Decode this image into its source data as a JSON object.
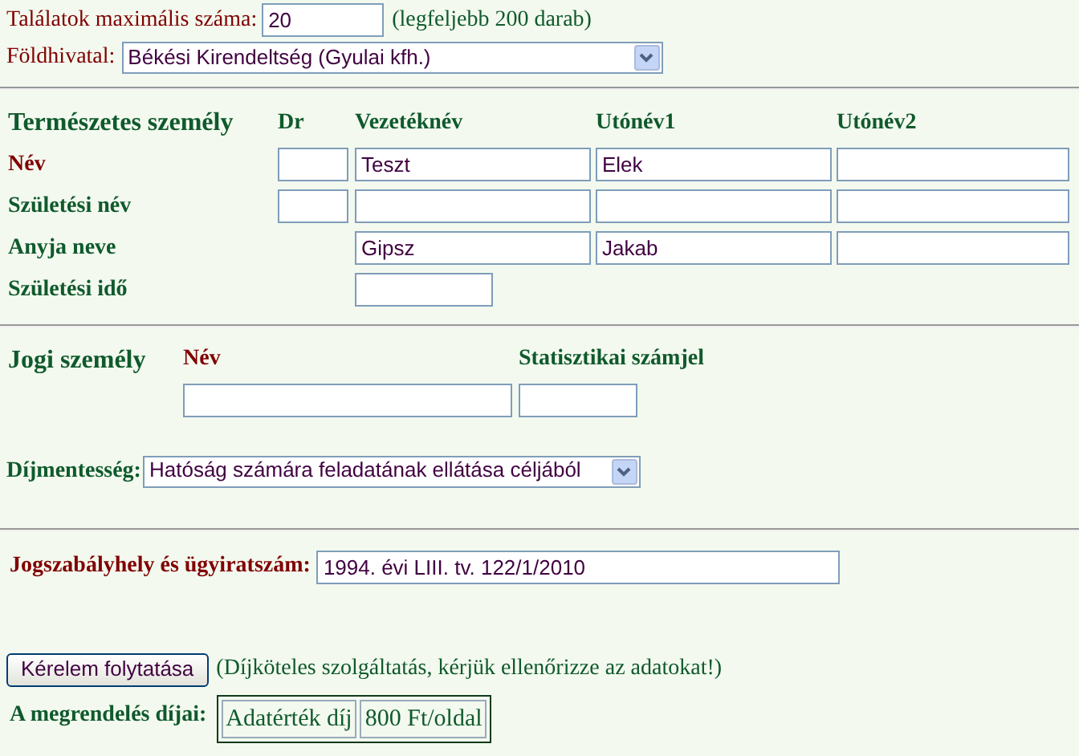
{
  "max_results": {
    "label": "Találatok maximális száma:",
    "value": "20",
    "note": "(legfeljebb 200 darab)"
  },
  "office": {
    "label": "Földhivatal:",
    "value": "Békési Kirendeltség (Gyulai kfh.)"
  },
  "natural_person": {
    "title": "Természetes személy",
    "columns": [
      "Dr",
      "Vezetéknév",
      "Utónév1",
      "Utónév2"
    ],
    "rows": [
      {
        "label": "Név",
        "color": "#800000",
        "fields": [
          {
            "kind": "title"
          },
          {
            "kind": "surname",
            "value": "Teszt"
          },
          {
            "kind": "given",
            "value": "Elek"
          },
          {
            "kind": "given2"
          }
        ]
      },
      {
        "label": "Születési név",
        "color": "#0f5a2c",
        "fields": [
          {
            "kind": "title"
          },
          {
            "kind": "surname"
          },
          {
            "kind": "given"
          },
          {
            "kind": "given2"
          }
        ]
      },
      {
        "label": "Anyja neve",
        "color": "#0f5a2c",
        "fields": [
          {
            "kind": "surname",
            "value": "Gipsz"
          },
          {
            "kind": "given",
            "value": "Jakab"
          },
          {
            "kind": "given2"
          }
        ]
      },
      {
        "label": "Születési idő",
        "color": "#0f5a2c",
        "fields": [
          {
            "kind": "date"
          }
        ]
      }
    ]
  },
  "legal_person": {
    "title": "Jogi személy",
    "name_label": "Név",
    "stat_label": "Statisztikai számjel"
  },
  "exemption": {
    "label": "Díjmentesség:",
    "value": "Hatóság számára feladatának ellátása céljából"
  },
  "legal_basis": {
    "label": "Jogszabályhely és ügyiratszám:",
    "value": "1994. évi LIII. tv. 122/1/2010"
  },
  "continue_button": {
    "label": "Kérelem folytatása",
    "note": "(Díjköteles szolgáltatás, kérjük ellenőrizze az adatokat!)"
  },
  "fees": {
    "label": "A megrendelés díjai:",
    "cells": [
      "Adatérték díj",
      "800 Ft/oldal"
    ]
  }
}
